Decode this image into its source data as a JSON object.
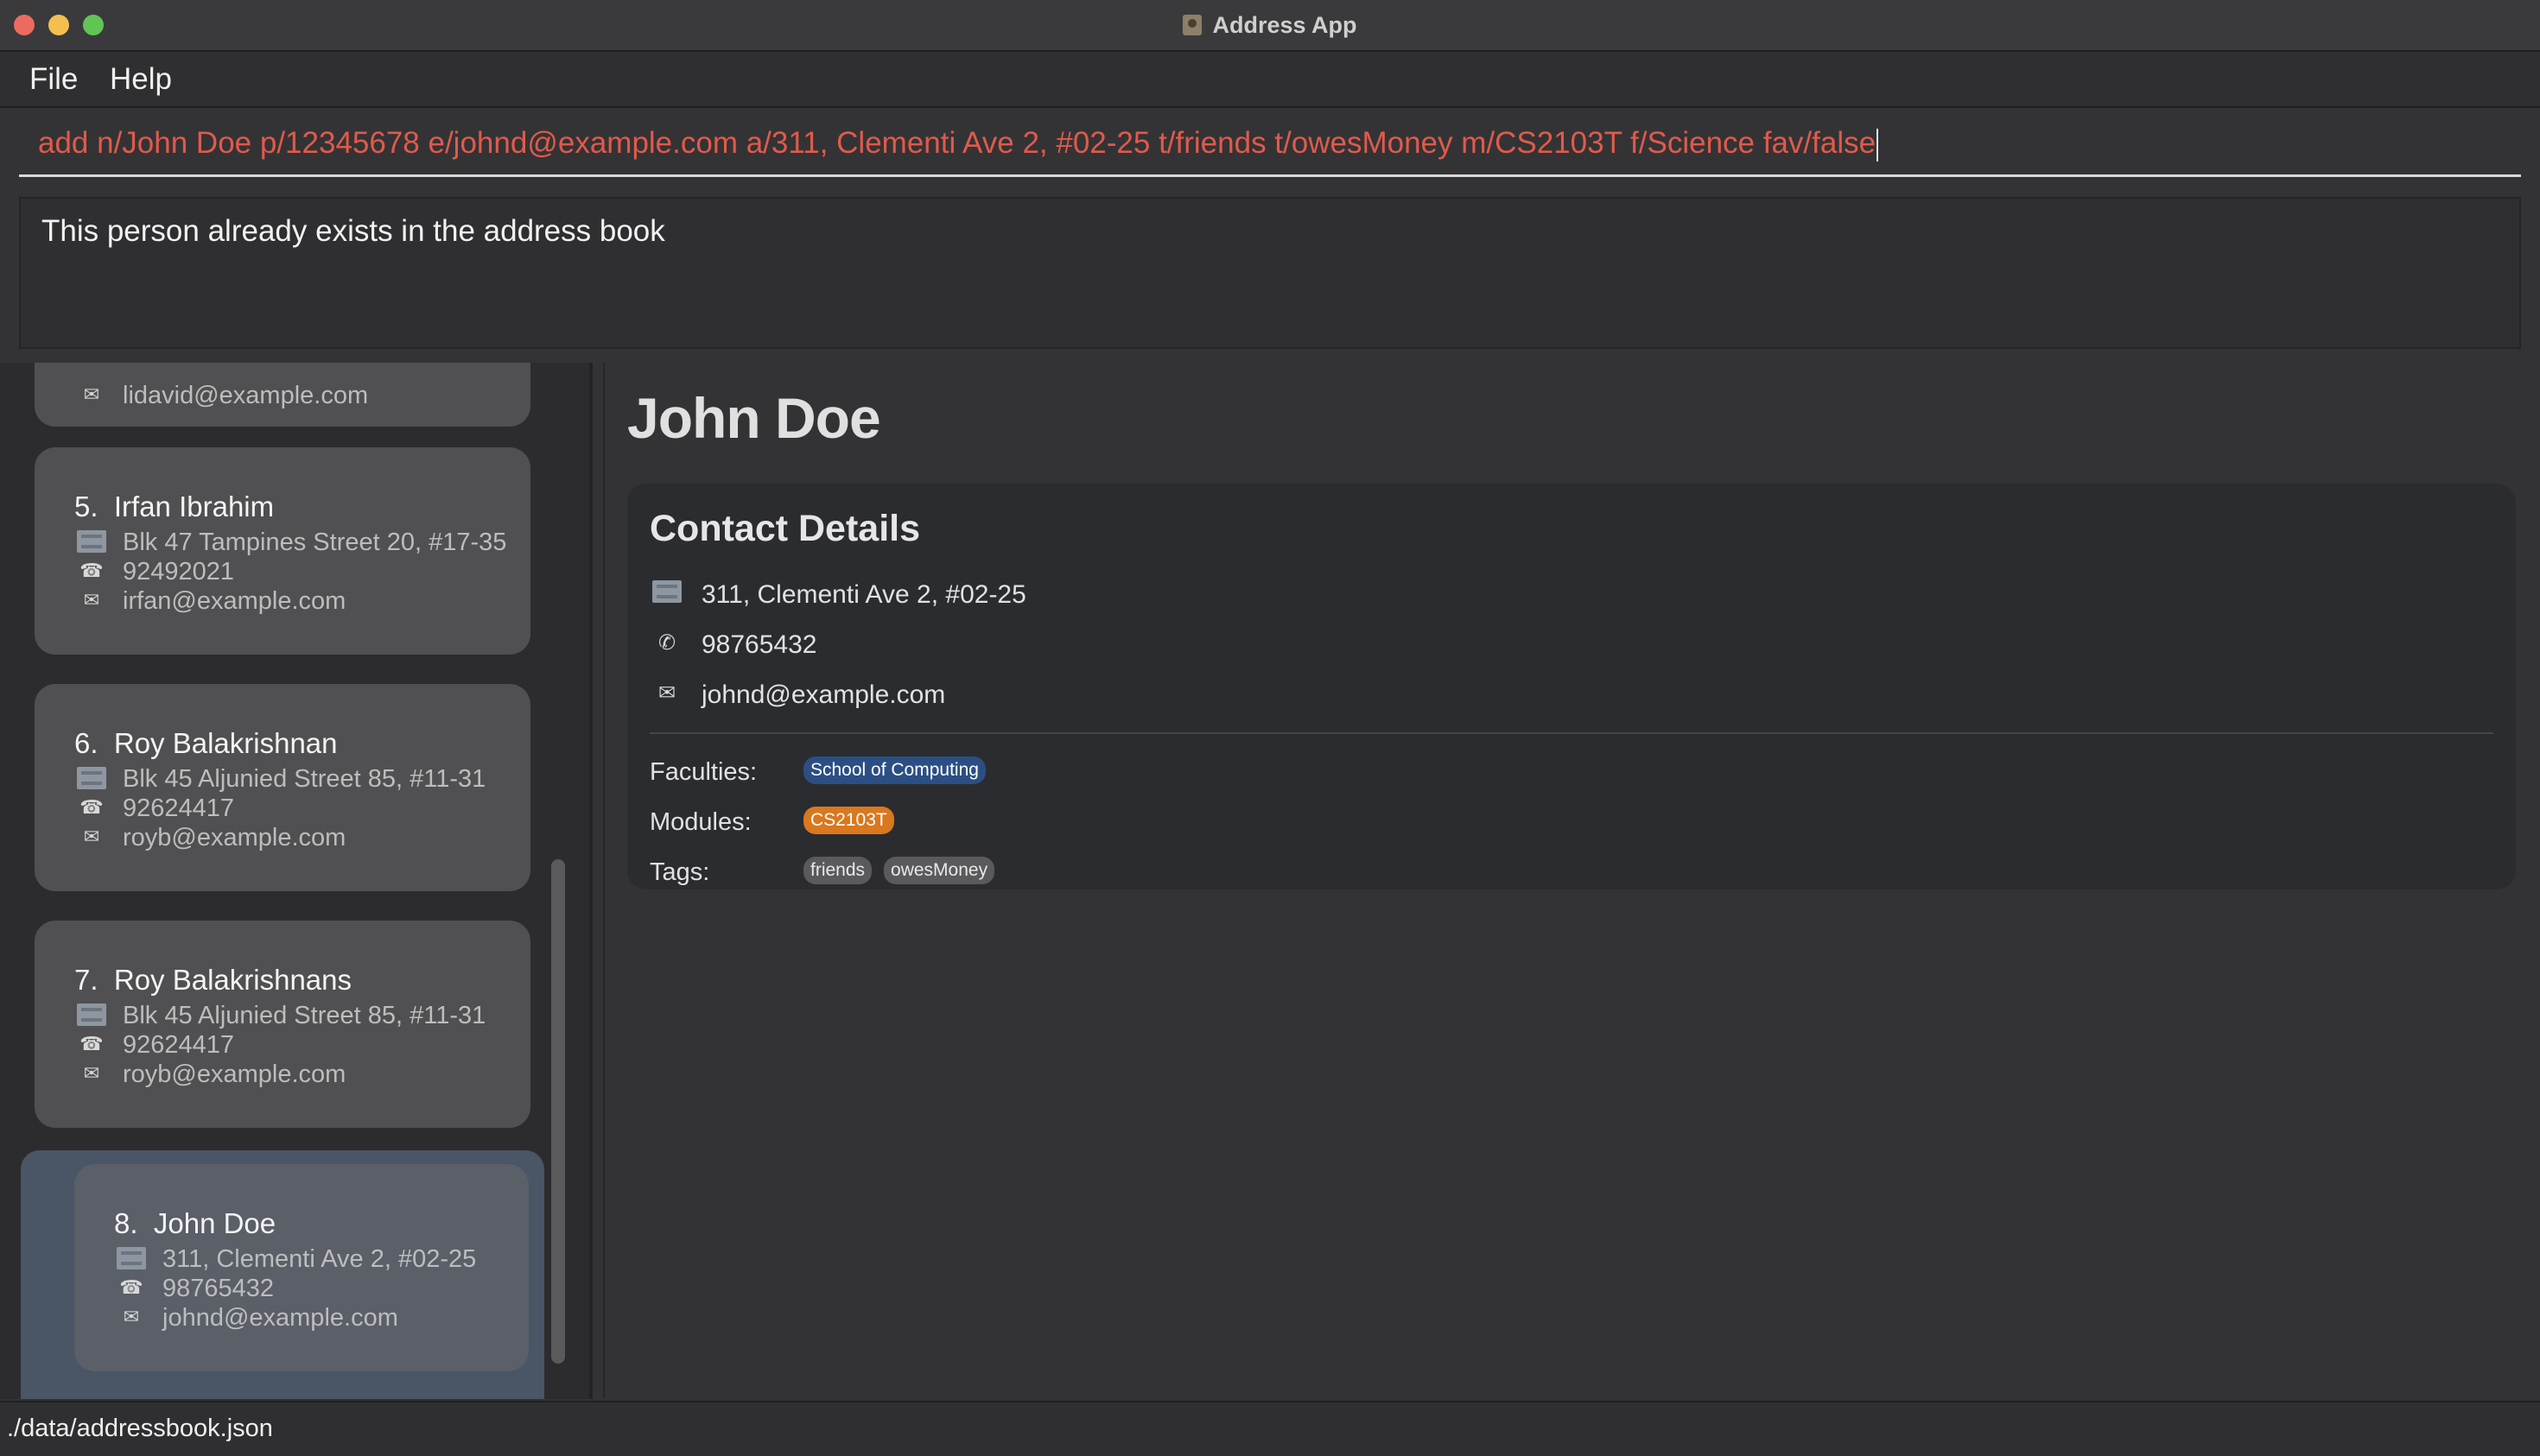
{
  "window": {
    "title": "Address App"
  },
  "menu": {
    "items": [
      "File",
      "Help"
    ]
  },
  "command": {
    "value": "add n/John Doe p/12345678 e/johnd@example.com a/311, Clementi Ave 2, #02-25 t/friends t/owesMoney m/CS2103T f/Science fav/false"
  },
  "result": {
    "message": "This person already exists in the address book"
  },
  "list": {
    "partial_email": "lidavid@example.com",
    "cards": [
      {
        "index": "5.",
        "name": "Irfan Ibrahim",
        "address": "Blk 47 Tampines Street 20, #17-35",
        "phone": "92492021",
        "email": "irfan@example.com"
      },
      {
        "index": "6.",
        "name": "Roy Balakrishnan",
        "address": "Blk 45 Aljunied Street 85, #11-31",
        "phone": "92624417",
        "email": "royb@example.com"
      },
      {
        "index": "7.",
        "name": "Roy Balakrishnans",
        "address": "Blk 45 Aljunied Street 85, #11-31",
        "phone": "92624417",
        "email": "royb@example.com"
      },
      {
        "index": "8.",
        "name": "John Doe",
        "address": "311, Clementi Ave 2, #02-25",
        "phone": "98765432",
        "email": "johnd@example.com"
      }
    ]
  },
  "detail": {
    "name": "John Doe",
    "section_title": "Contact Details",
    "address": "311, Clementi Ave 2, #02-25",
    "phone": "98765432",
    "email": "johnd@example.com",
    "labels": {
      "faculties": "Faculties:",
      "modules": "Modules:",
      "tags": "Tags:"
    },
    "faculties": [
      "School of Computing"
    ],
    "modules": [
      "CS2103T"
    ],
    "tags": [
      "friends",
      "owesMoney"
    ]
  },
  "status": {
    "path": "./data/addressbook.json"
  },
  "icons": {
    "address": "building-icon",
    "phone": "phone-icon",
    "email": "envelope-icon"
  },
  "colors": {
    "command_error": "#e05a4b",
    "faculty_chip": "#2b4f84",
    "module_chip": "#d9781e",
    "tag_chip": "#5a5a5d",
    "selected_card": "#4a5566"
  }
}
